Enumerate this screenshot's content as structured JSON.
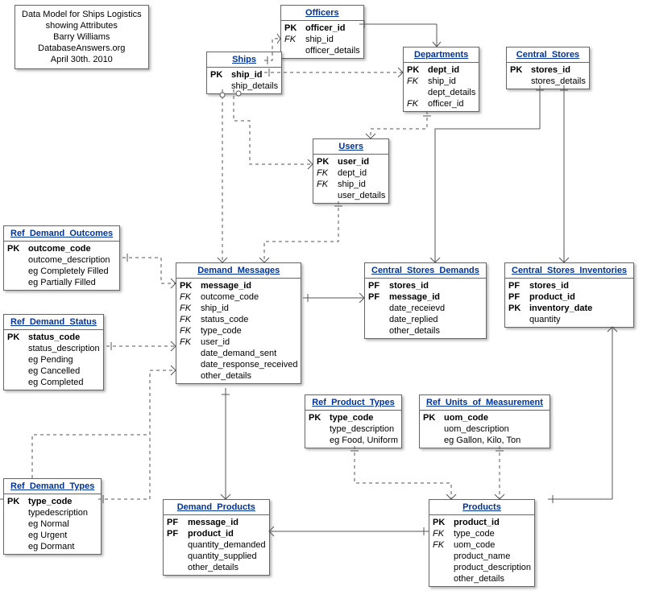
{
  "info": {
    "l1": "Data Model for Ships Logistics",
    "l2": "showing Attributes",
    "l3": "Barry Williams",
    "l4": "DatabaseAnswers.org",
    "l5": "April 30th. 2010"
  },
  "entities": {
    "officers": {
      "title": "Officers",
      "rows": [
        {
          "k": "PK",
          "a": "officer_id",
          "pk": 1
        },
        {
          "k": "FK",
          "a": "ship_id",
          "fk": 1
        },
        {
          "k": "",
          "a": "officer_details"
        }
      ]
    },
    "ships": {
      "title": "Ships",
      "rows": [
        {
          "k": "PK",
          "a": "ship_id",
          "pk": 1
        },
        {
          "k": "",
          "a": "ship_details"
        }
      ]
    },
    "departments": {
      "title": "Departments",
      "rows": [
        {
          "k": "PK",
          "a": "dept_id",
          "pk": 1
        },
        {
          "k": "FK",
          "a": "ship_id",
          "fk": 1
        },
        {
          "k": "",
          "a": "dept_details"
        },
        {
          "k": "FK",
          "a": "officer_id",
          "fk": 1
        }
      ]
    },
    "central_stores": {
      "title": "Central_Stores",
      "rows": [
        {
          "k": "PK",
          "a": "stores_id",
          "pk": 1
        },
        {
          "k": "",
          "a": "stores_details"
        }
      ]
    },
    "users": {
      "title": "Users",
      "rows": [
        {
          "k": "PK",
          "a": "user_id",
          "pk": 1
        },
        {
          "k": "FK",
          "a": "dept_id",
          "fk": 1
        },
        {
          "k": "FK",
          "a": "ship_id",
          "fk": 1
        },
        {
          "k": "",
          "a": "user_details"
        }
      ]
    },
    "ref_demand_outcomes": {
      "title": "Ref_Demand_Outcomes",
      "rows": [
        {
          "k": "PK",
          "a": "outcome_code",
          "pk": 1
        },
        {
          "k": "",
          "a": "outcome_description"
        },
        {
          "k": "",
          "a": "eg Completely Filled"
        },
        {
          "k": "",
          "a": "eg Partially Filled"
        }
      ]
    },
    "demand_messages": {
      "title": "Demand_Messages",
      "rows": [
        {
          "k": "PK",
          "a": "message_id",
          "pk": 1
        },
        {
          "k": "FK",
          "a": "outcome_code",
          "fk": 1
        },
        {
          "k": "FK",
          "a": "ship_id",
          "fk": 1
        },
        {
          "k": "FK",
          "a": "status_code",
          "fk": 1
        },
        {
          "k": "FK",
          "a": "type_code",
          "fk": 1
        },
        {
          "k": "FK",
          "a": "user_id",
          "fk": 1
        },
        {
          "k": "",
          "a": "date_demand_sent"
        },
        {
          "k": "",
          "a": "date_response_received"
        },
        {
          "k": "",
          "a": "other_details"
        }
      ]
    },
    "central_stores_demands": {
      "title": "Central_Stores_Demands",
      "rows": [
        {
          "k": "PF",
          "a": "stores_id",
          "pk": 1
        },
        {
          "k": "PF",
          "a": "message_id",
          "pk": 1
        },
        {
          "k": "",
          "a": "date_receievd"
        },
        {
          "k": "",
          "a": "date_replied"
        },
        {
          "k": "",
          "a": "other_details"
        }
      ]
    },
    "central_stores_inventories": {
      "title": "Central_Stores_Inventories",
      "rows": [
        {
          "k": "PF",
          "a": "stores_id",
          "pk": 1
        },
        {
          "k": "PF",
          "a": "product_id",
          "pk": 1
        },
        {
          "k": "PK",
          "a": "inventory_date",
          "pk": 1
        },
        {
          "k": "",
          "a": "quantity"
        }
      ]
    },
    "ref_demand_status": {
      "title": "Ref_Demand_Status",
      "rows": [
        {
          "k": "PK",
          "a": "status_code",
          "pk": 1
        },
        {
          "k": "",
          "a": "status_description"
        },
        {
          "k": "",
          "a": "eg Pending"
        },
        {
          "k": "",
          "a": "eg Cancelled"
        },
        {
          "k": "",
          "a": "eg Completed"
        }
      ]
    },
    "ref_product_types": {
      "title": "Ref_Product_Types",
      "rows": [
        {
          "k": "PK",
          "a": "type_code",
          "pk": 1
        },
        {
          "k": "",
          "a": "type_description"
        },
        {
          "k": "",
          "a": "eg Food, Uniform"
        }
      ]
    },
    "ref_units_of_measurement": {
      "title": "Ref_Units_of_Measurement",
      "rows": [
        {
          "k": "PK",
          "a": "uom_code",
          "pk": 1
        },
        {
          "k": "",
          "a": "uom_description"
        },
        {
          "k": "",
          "a": "eg Gallon, Kilo, Ton"
        }
      ]
    },
    "ref_demand_types": {
      "title": "Ref_Demand_Types",
      "rows": [
        {
          "k": "PK",
          "a": "type_code",
          "pk": 1
        },
        {
          "k": "",
          "a": "typedescription"
        },
        {
          "k": "",
          "a": "eg Normal"
        },
        {
          "k": "",
          "a": "eg Urgent"
        },
        {
          "k": "",
          "a": "eg Dormant"
        }
      ]
    },
    "demand_products": {
      "title": "Demand_Products",
      "rows": [
        {
          "k": "PF",
          "a": "message_id",
          "pk": 1
        },
        {
          "k": "PF",
          "a": "product_id",
          "pk": 1
        },
        {
          "k": "",
          "a": "quantity_demanded"
        },
        {
          "k": "",
          "a": "quantity_supplied"
        },
        {
          "k": "",
          "a": "other_details"
        }
      ]
    },
    "products": {
      "title": "Products",
      "rows": [
        {
          "k": "PK",
          "a": "product_id",
          "pk": 1
        },
        {
          "k": "FK",
          "a": "type_code",
          "fk": 1
        },
        {
          "k": "FK",
          "a": "uom_code",
          "fk": 1
        },
        {
          "k": "",
          "a": "product_name"
        },
        {
          "k": "",
          "a": "product_description"
        },
        {
          "k": "",
          "a": "other_details"
        }
      ]
    }
  }
}
